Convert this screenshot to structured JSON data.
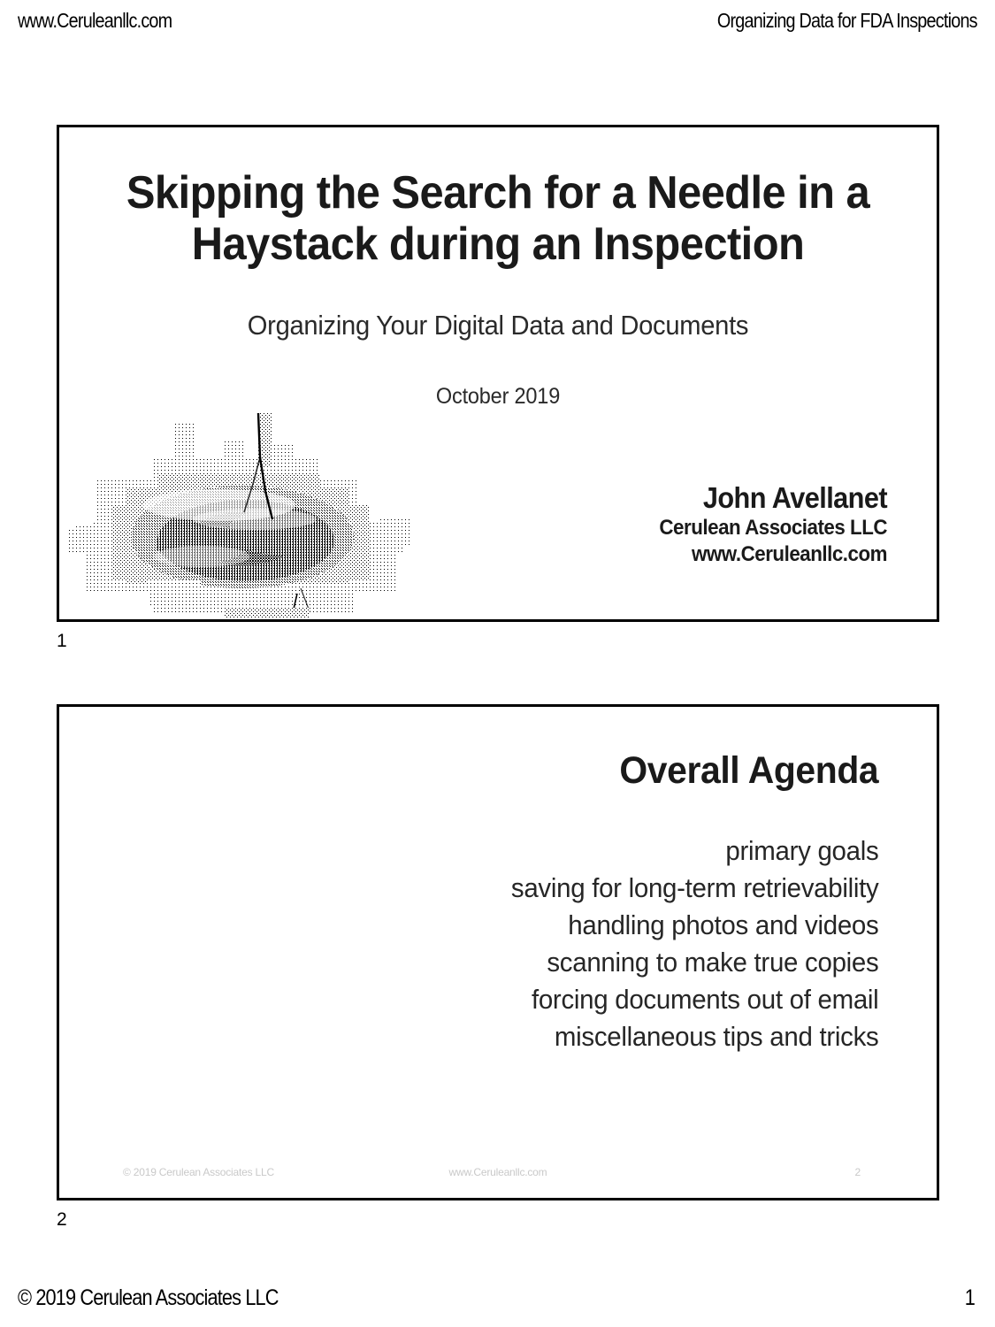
{
  "page": {
    "header": {
      "left": "www.Ceruleanllc.com",
      "right": "Organizing Data for FDA Inspections"
    },
    "footer": {
      "copyright": "© 2019 Cerulean Associates LLC",
      "page_number": "1"
    }
  },
  "slides": [
    {
      "index_label": "1",
      "title": "Skipping the Search for a Needle in a Haystack during an Inspection",
      "subtitle": "Organizing Your Digital Data and Documents",
      "date": "October 2019",
      "presenter": {
        "name": "John Avellanet",
        "organization": "Cerulean Associates LLC",
        "website": "www.Ceruleanllc.com"
      },
      "image": {
        "name": "haystack-photo",
        "description": "halftone dithered photograph of a haystack"
      }
    },
    {
      "index_label": "2",
      "title": "Overall Agenda",
      "agenda_items": [
        "primary goals",
        "saving for long-term retrievability",
        "handling photos and videos",
        "scanning to make true copies",
        "forcing documents out of email",
        "miscellaneous tips and tricks"
      ],
      "footer": {
        "left": "© 2019 Cerulean Associates LLC",
        "center": "www.Ceruleanllc.com",
        "right": "2"
      }
    }
  ],
  "colors": {
    "ink": "#000000",
    "paper": "#ffffff",
    "faint_footer": "#c9c9c9"
  }
}
